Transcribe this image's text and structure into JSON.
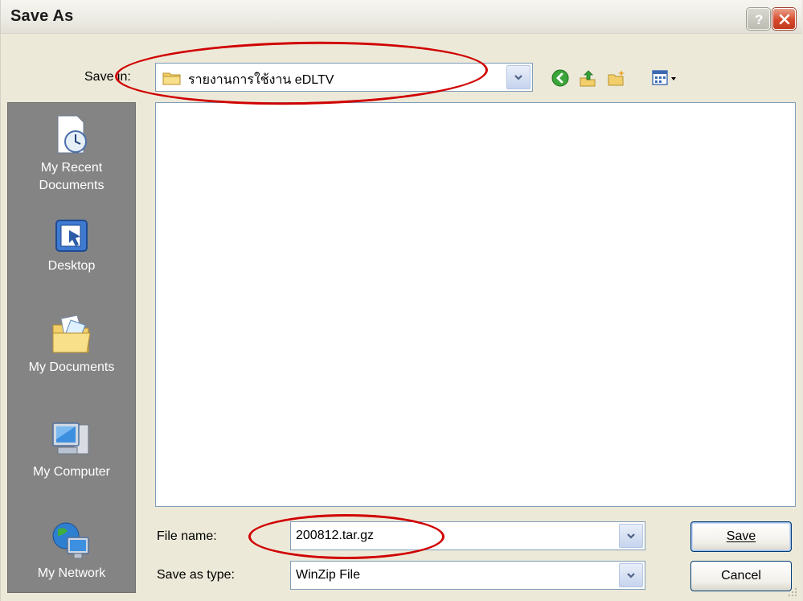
{
  "window": {
    "title": "Save As",
    "help_icon": "help-icon",
    "close_icon": "close-icon"
  },
  "save_in": {
    "label": "Save in:",
    "value": "รายงานการใช้งาน eDLTV",
    "folder_icon": "folder-icon"
  },
  "toolbar": {
    "icons": [
      "back-icon",
      "up-folder-icon",
      "new-folder-icon",
      "view-menu-icon"
    ]
  },
  "places": [
    {
      "label": "My Recent\nDocuments",
      "icon": "recent-documents-icon"
    },
    {
      "label": "Desktop",
      "icon": "desktop-icon"
    },
    {
      "label": "My Documents",
      "icon": "my-documents-icon"
    },
    {
      "label": "My Computer",
      "icon": "my-computer-icon"
    },
    {
      "label": "My Network",
      "icon": "my-network-icon"
    }
  ],
  "file_name": {
    "label": "File name:",
    "value": "200812.tar.gz"
  },
  "save_as_type": {
    "label": "Save as type:",
    "value": "WinZip File"
  },
  "buttons": {
    "save": "Save",
    "cancel": "Cancel"
  },
  "colors": {
    "annotation": "#d00000",
    "places_bg": "#848484",
    "dialog_bg": "#ece9d8"
  }
}
